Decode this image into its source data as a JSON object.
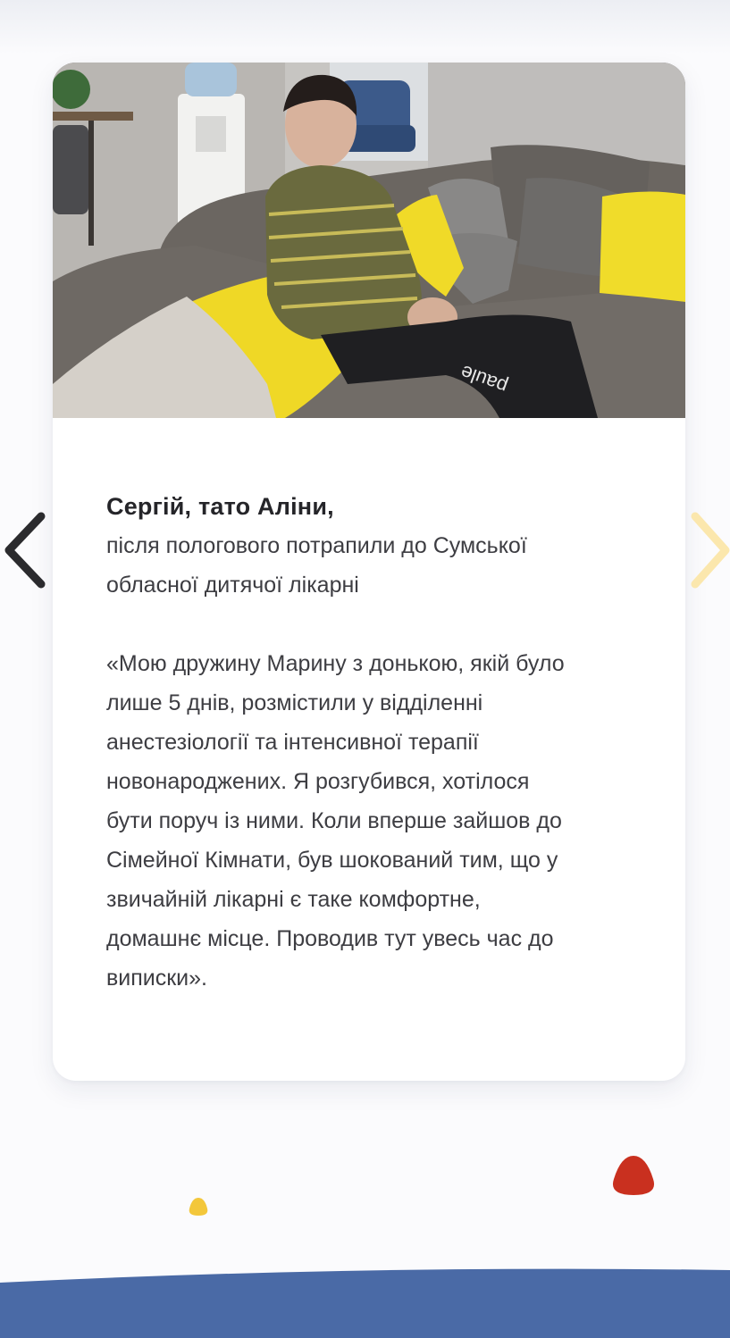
{
  "testimonial": {
    "photo_alt": "Сергій, тато Аліни",
    "name": "Сергій, тато Аліни,",
    "description_lines": [
      "після пологового потрапили до Сумської",
      "обласної дитячої лікарні"
    ],
    "quote_lines": [
      "«Мою дружину Марину з донькою, якій було",
      "лише 5 днів, розмістили у відділенні",
      "анестезіології та інтенсивної терапії",
      "новонароджених. Я розгубився, хотілося",
      "бути поруч із ними. Коли вперше зайшов до",
      "Сімейної Кімнати, був шокований тим, що у",
      "звичайній лікарні є таке комфортне,",
      "домашнє місце. Проводив тут увесь час до",
      "виписки»."
    ],
    "photo_print_text": "paule"
  },
  "carousel": {
    "prev_icon": "chevron-left-icon",
    "next_icon": "chevron-right-icon",
    "prev_color": "#2b2b2e",
    "next_color": "#fbe7ad"
  },
  "colors": {
    "accent_red": "#c9301f",
    "accent_yellow": "#f3c73b",
    "wave_blue": "#4a6aa6"
  }
}
